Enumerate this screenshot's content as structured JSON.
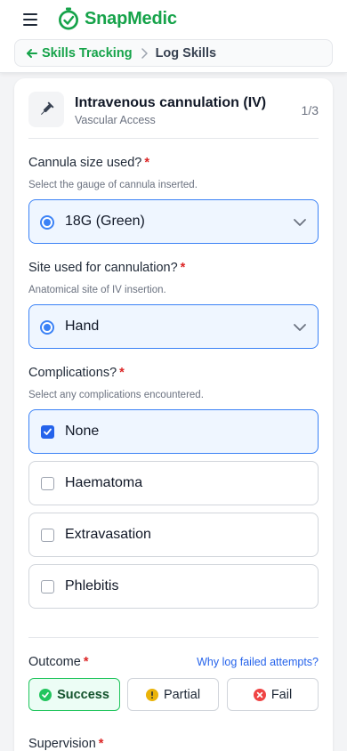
{
  "app": {
    "name": "SnapMedic",
    "brand_color": "#16a34a"
  },
  "breadcrumb": {
    "back_label": "Skills Tracking",
    "current": "Log Skills"
  },
  "skill": {
    "title": "Intravenous cannulation (IV)",
    "category": "Vascular Access",
    "progress": "1/3"
  },
  "questions": {
    "cannula": {
      "label": "Cannula size used?",
      "required": "*",
      "help": "Select the gauge of cannula inserted.",
      "value": "18G (Green)"
    },
    "site": {
      "label": "Site used for cannulation?",
      "required": "*",
      "help": "Anatomical site of IV insertion.",
      "value": "Hand"
    },
    "complications": {
      "label": "Complications?",
      "required": "*",
      "help": "Select any complications encountered.",
      "options": [
        {
          "label": "None",
          "checked": true
        },
        {
          "label": "Haematoma",
          "checked": false
        },
        {
          "label": "Extravasation",
          "checked": false
        },
        {
          "label": "Phlebitis",
          "checked": false
        }
      ]
    }
  },
  "outcome": {
    "label": "Outcome",
    "required": "*",
    "help_link": "Why log failed attempts?",
    "options": [
      {
        "label": "Success",
        "icon": "check-circle-icon",
        "color": "#22c55e",
        "selected": true
      },
      {
        "label": "Partial",
        "icon": "warning-circle-icon",
        "color": "#eab308",
        "selected": false
      },
      {
        "label": "Fail",
        "icon": "x-circle-icon",
        "color": "#ef4444",
        "selected": false
      }
    ]
  },
  "supervision": {
    "label": "Supervision",
    "required": "*"
  }
}
